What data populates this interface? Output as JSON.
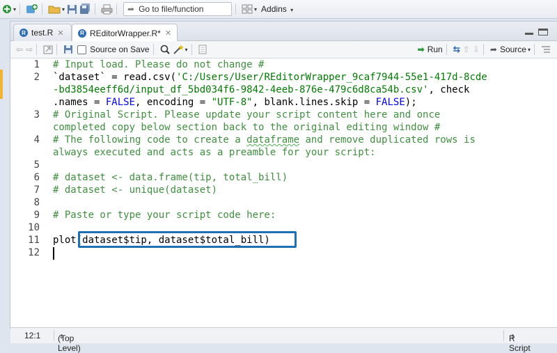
{
  "toolbar": {
    "goto_placeholder": "Go to file/function",
    "addins_label": "Addins"
  },
  "tabs": [
    {
      "label": "test.R"
    },
    {
      "label": "REditorWrapper.R*"
    }
  ],
  "editor_toolbar": {
    "source_on_save_label": "Source on Save",
    "run_label": "Run",
    "source_label": "Source"
  },
  "code_lines": [
    {
      "num": "1",
      "text": "# Input load. Please do not change #"
    },
    {
      "num": "2",
      "text": "`dataset` = read.csv('C:/Users/User/REditorWrapper_9caf7944-55e1-417d-8cde"
    },
    {
      "num": "",
      "text": "-bd3854eeff6d/input_df_5bd034f6-9842-4eeb-876e-479c6d8ca54b.csv', check"
    },
    {
      "num": "",
      "text": ".names = FALSE, encoding = \"UTF-8\", blank.lines.skip = FALSE);"
    },
    {
      "num": "3",
      "text": "# Original Script. Please update your script content here and once"
    },
    {
      "num": "",
      "text": "completed copy below section back to the original editing window #"
    },
    {
      "num": "4",
      "text": "# The following code to create a dataframe and remove duplicated rows is"
    },
    {
      "num": "",
      "text": "always executed and acts as a preamble for your script:"
    },
    {
      "num": "5",
      "text": ""
    },
    {
      "num": "6",
      "text": "# dataset <- data.frame(tip, total_bill)"
    },
    {
      "num": "7",
      "text": "# dataset <- unique(dataset)"
    },
    {
      "num": "8",
      "text": ""
    },
    {
      "num": "9",
      "text": "# Paste or type your script code here:"
    },
    {
      "num": "10",
      "text": ""
    },
    {
      "num": "11",
      "text": "plot(dataset$tip, dataset$total_bill)"
    },
    {
      "num": "12",
      "text": ""
    }
  ],
  "status": {
    "position": "12:1",
    "scope": "(Top Level)",
    "file_type": "R Script"
  },
  "colors": {
    "comment": "#3f8f3f",
    "keyword": "#0000ff",
    "highlight_box": "#1f6fb5"
  }
}
